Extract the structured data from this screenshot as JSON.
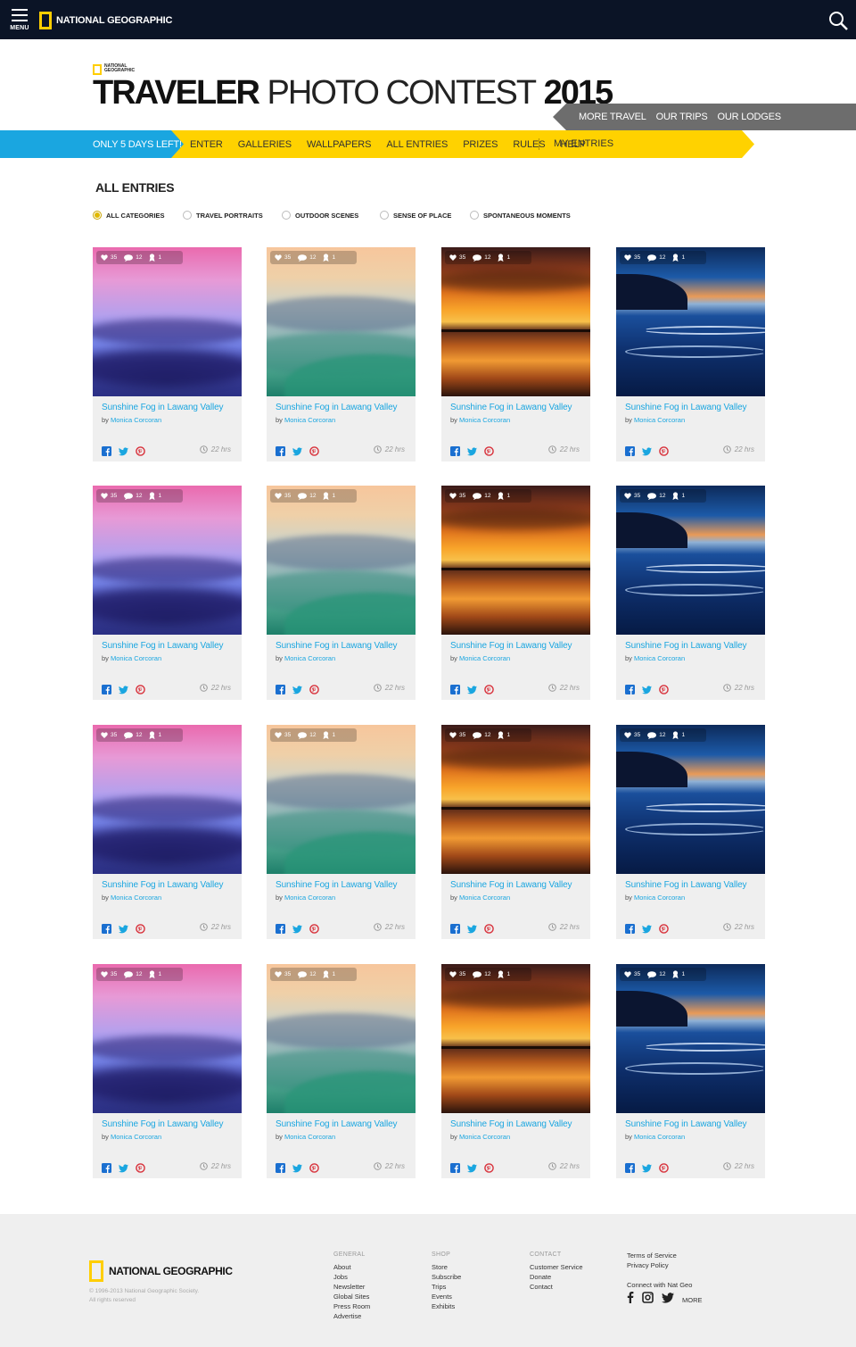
{
  "topbar": {
    "menu_label": "MENU",
    "brand": "NATIONAL GEOGRAPHIC"
  },
  "contest": {
    "small_brand_1": "NATIONAL",
    "small_brand_2": "GEOGRAPHIC",
    "title_bold": "TRAVELER",
    "title_light": "PHOTO CONTEST",
    "title_year": "2015"
  },
  "more_travel": [
    "MORE TRAVEL",
    "OUR TRIPS",
    "OUR LODGES"
  ],
  "nav": {
    "countdown": "ONLY 5 DAYS LEFT!",
    "items": [
      "ENTER",
      "GALLERIES",
      "WALLPAPERS",
      "ALL ENTRIES",
      "PRIZES",
      "RULES",
      "HELP"
    ],
    "my_entries": "MY ENTRIES"
  },
  "section_title": "ALL ENTRIES",
  "filters": [
    {
      "label": "ALL CATEGORIES",
      "selected": true
    },
    {
      "label": "TRAVEL PORTRAITS",
      "selected": false
    },
    {
      "label": "OUTDOOR SCENES",
      "selected": false
    },
    {
      "label": "SENSE OF PLACE",
      "selected": false
    },
    {
      "label": "SPONTANEOUS MOMENTS",
      "selected": false
    }
  ],
  "entry_template": {
    "likes": "35",
    "comments": "12",
    "awards": "1",
    "title": "Sunshine Fog in Lawang Valley",
    "by": "by",
    "author": "Monica Corcoran",
    "time": "22 hrs"
  },
  "photo_variants": [
    "pink-fog",
    "misty-hills",
    "orange-sunset",
    "blue-beach"
  ],
  "rows": 4,
  "footer": {
    "brand": "NATIONAL GEOGRAPHIC",
    "copyright_1": "© 1996-2013 National Geographic Society.",
    "copyright_2": "All rights reserved",
    "general": {
      "head": "GENERAL",
      "links": [
        "About",
        "Jobs",
        "Newsletter",
        "Global Sites",
        "Press Room",
        "Advertise"
      ]
    },
    "shop": {
      "head": "SHOP",
      "links": [
        "Store",
        "Subscribe",
        "Trips",
        "Events",
        "Exhibits"
      ]
    },
    "contact": {
      "head": "CONTACT",
      "links": [
        "Customer Service",
        "Donate",
        "Contact"
      ]
    },
    "legal": [
      "Terms of Service",
      "Privacy Policy"
    ],
    "connect": "Connect with Nat Geo",
    "more": "MORE"
  },
  "colors": {
    "topbar": "#0b1426",
    "accent_yellow": "#ffd200",
    "accent_blue": "#1aa6e0",
    "gray_bar": "#6d6d6d"
  }
}
